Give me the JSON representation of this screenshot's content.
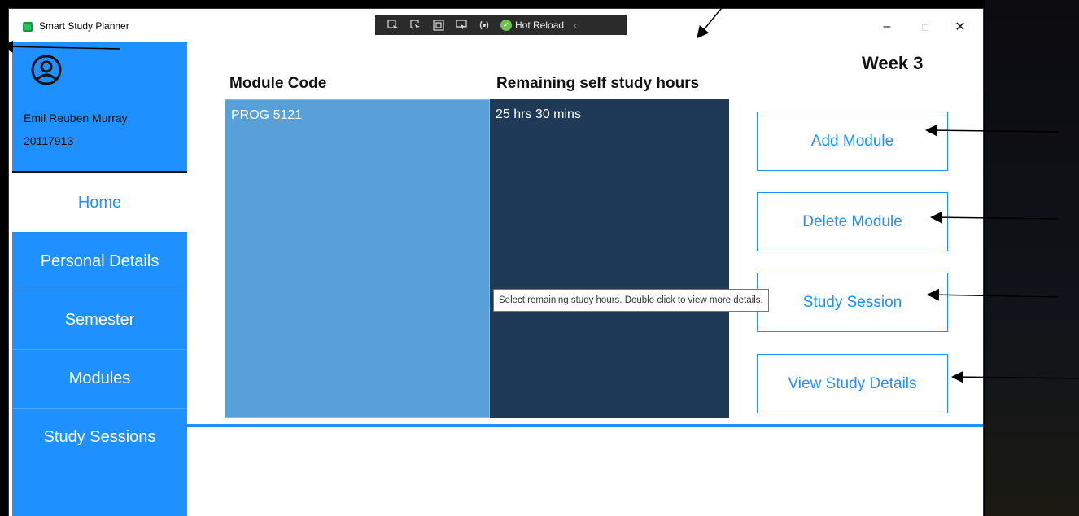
{
  "window": {
    "title": "Smart Study Planner",
    "controls": {
      "minimize": "–",
      "maximize": "□",
      "close": "✕"
    }
  },
  "hot_reload_toolbar": {
    "label": "Hot Reload",
    "icons": [
      "select-element-icon",
      "pointer-icon",
      "layout-adorner-icon",
      "track-focus-icon",
      "binding-icon",
      "hot-reload-check-icon"
    ]
  },
  "user": {
    "name": "Emil Reuben Murray",
    "student_number": "20117913"
  },
  "nav": {
    "home": "Home",
    "personal_details": "Personal Details",
    "semester": "Semester",
    "modules": "Modules",
    "study_sessions": "Study Sessions"
  },
  "main": {
    "week_label": "Week 3",
    "columns": {
      "module_code": "Module Code",
      "remaining_hours": "Remaining self study hours"
    },
    "rows": [
      {
        "module_code": "PROG 5121",
        "remaining_hours": "25 hrs 30 mins"
      }
    ],
    "buttons": {
      "add_module": "Add Module",
      "delete_module": "Delete Module",
      "study_session": "Study Session",
      "view_study_details": "View Study Details"
    },
    "tooltip": "Select remaining study hours. Double click to view more details."
  },
  "colors": {
    "accent": "#1e90ff",
    "module_column": "#5aa0d8",
    "hours_column": "#1f3a56"
  }
}
